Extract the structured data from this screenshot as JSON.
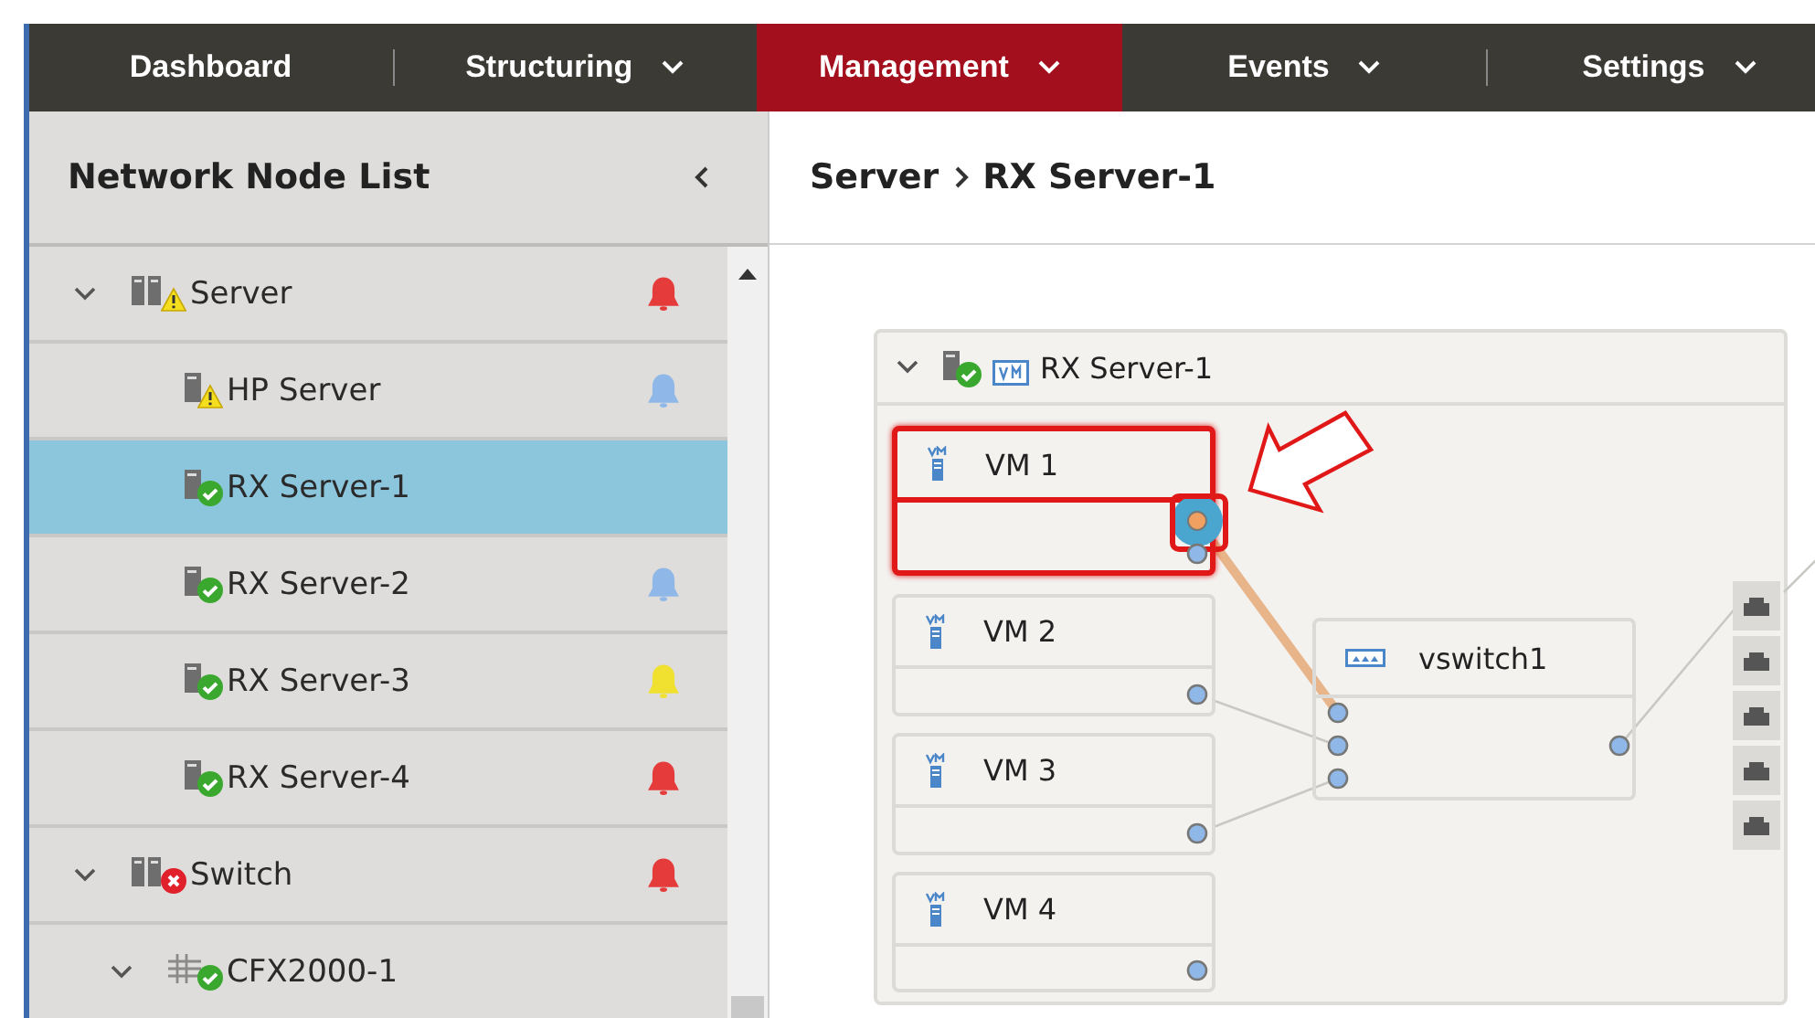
{
  "nav": [
    {
      "label": "Dashboard",
      "dropdown": false,
      "selected": false
    },
    {
      "label": "Structuring",
      "dropdown": true,
      "selected": false
    },
    {
      "label": "Management",
      "dropdown": true,
      "selected": true
    },
    {
      "label": "Events",
      "dropdown": true,
      "selected": false
    },
    {
      "label": "Settings",
      "dropdown": true,
      "selected": false
    }
  ],
  "sidebar": {
    "title": "Network Node List",
    "tree": [
      {
        "label": "Server",
        "kind": "group",
        "status": {
          "kind": "warning"
        },
        "alarm": {
          "color": "#e53b3b"
        },
        "expanded": true,
        "selected": false,
        "children": [
          {
            "label": "HP Server",
            "kind": "server",
            "status": {
              "kind": "warning"
            },
            "alarm": {
              "color": "#8fb8e8"
            },
            "selected": false
          },
          {
            "label": "RX Server-1",
            "kind": "server",
            "status": {
              "kind": "ok"
            },
            "selected": true
          },
          {
            "label": "RX Server-2",
            "kind": "server",
            "status": {
              "kind": "ok"
            },
            "alarm": {
              "color": "#8fb8e8"
            },
            "selected": false
          },
          {
            "label": "RX Server-3",
            "kind": "server",
            "status": {
              "kind": "ok"
            },
            "alarm": {
              "color": "#f0e030"
            },
            "selected": false
          },
          {
            "label": "RX Server-4",
            "kind": "server",
            "status": {
              "kind": "ok"
            },
            "alarm": {
              "color": "#e53b3b"
            },
            "selected": false
          }
        ]
      },
      {
        "label": "Switch",
        "kind": "group",
        "status": {
          "kind": "error"
        },
        "alarm": {
          "color": "#e53b3b"
        },
        "expanded": true,
        "selected": false,
        "children": [
          {
            "label": "CFX2000-1",
            "kind": "switch",
            "status": {
              "kind": "ok"
            },
            "expanded": true,
            "selected": false
          }
        ]
      }
    ]
  },
  "breadcrumb": [
    "Server",
    "RX Server-1"
  ],
  "diagram": {
    "title": "RX Server-1",
    "expanded": true,
    "vms": [
      {
        "name": "VM 1",
        "highlighted": true
      },
      {
        "name": "VM 2",
        "highlighted": false
      },
      {
        "name": "VM 3",
        "highlighted": false
      },
      {
        "name": "VM 4",
        "highlighted": false
      }
    ],
    "vswitch": "vswitch1"
  }
}
